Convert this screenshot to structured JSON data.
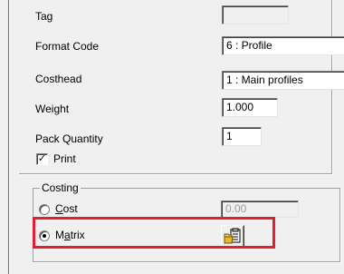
{
  "form": {
    "tag": {
      "label": "Tag",
      "value": ""
    },
    "format_code": {
      "label": "Format Code",
      "value": "6 : Profile"
    },
    "costhead": {
      "label": "Costhead",
      "value": "1   : Main profiles"
    },
    "weight": {
      "label": "Weight",
      "value": "1.000"
    },
    "pack_quantity": {
      "label": "Pack Quantity",
      "value": "1"
    },
    "print": {
      "label": "Print",
      "checked": true,
      "mark": "✓"
    }
  },
  "costing": {
    "title": "Costing",
    "cost": {
      "label": "Cost",
      "value": "0.00",
      "selected": false
    },
    "matrix": {
      "label": "Matrix",
      "selected": true
    }
  },
  "icons": {
    "matrix_button": "clipboard-folder-icon"
  },
  "colors": {
    "highlight": "#e02030",
    "panel": "#f0f0f0"
  }
}
